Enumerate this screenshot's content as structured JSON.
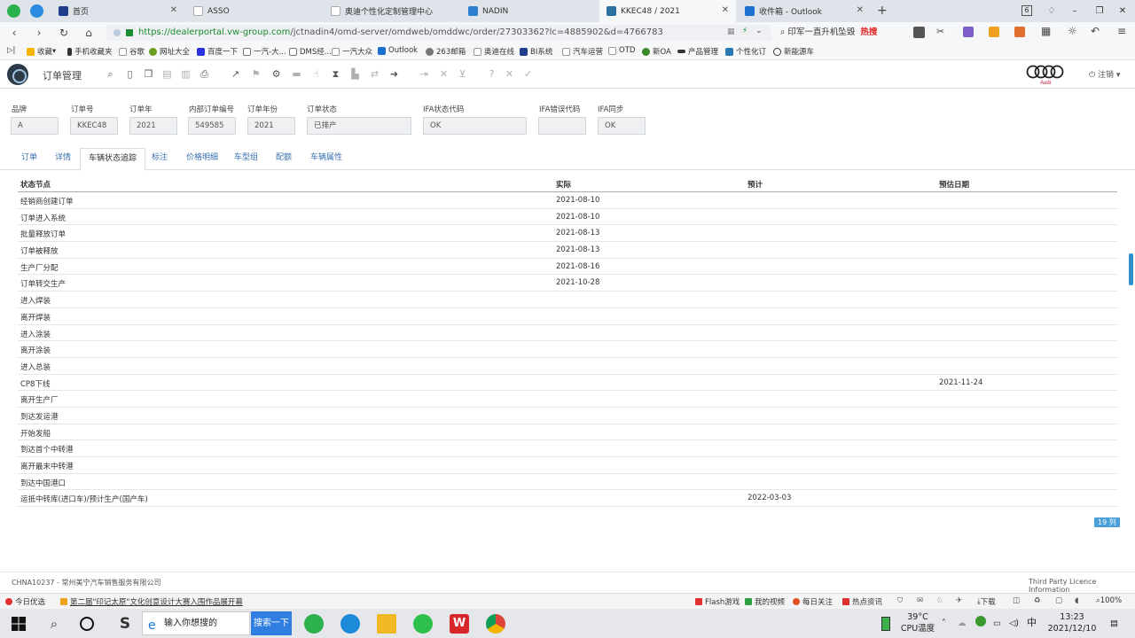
{
  "browser": {
    "tabs": [
      {
        "label": "首页",
        "color": "#1f3f8c"
      },
      {
        "label": "ASSO",
        "color": "#aaaaaa"
      },
      {
        "label": "奥迪个性化定制管理中心",
        "color": "#aaaaaa"
      },
      {
        "label": "NADIN",
        "color": "#2d7fcf"
      },
      {
        "label": "KKEC48 / 2021",
        "color": "#2d6f9f"
      },
      {
        "label": "收件箱 - Outlook",
        "color": "#1d6fd0"
      }
    ],
    "tab_count": "6",
    "url_scheme": "https://",
    "url_host": "dealerportal.vw-group.com",
    "url_path": "/jctnadin4/omd-server/omdweb/omddwc/order/27303362?lc=4885902&d=4766783",
    "search_text": "印军一直升机坠毁",
    "search_hot": "热搜",
    "bookmarks": [
      "收藏",
      "手机收藏夹",
      "谷歌",
      "网址大全",
      "百度一下",
      "一汽-大...",
      "DMS经...",
      "一汽大众",
      "Outlook",
      "263邮箱",
      "奥迪在线",
      "BI系统",
      "汽车运营",
      "OTD",
      "新OA",
      "产品管理",
      "个性化订",
      "新能源车"
    ]
  },
  "app": {
    "title": "订单管理",
    "brand": "Audi",
    "logout": "注销"
  },
  "fields": [
    {
      "label": "品牌",
      "value": "A"
    },
    {
      "label": "订单号",
      "value": "KKEC48"
    },
    {
      "label": "订单年",
      "value": "2021"
    },
    {
      "label": "内部订单编号",
      "value": "549585"
    },
    {
      "label": "订单年份",
      "value": "2021"
    },
    {
      "label": "订单状态",
      "value": "已排产"
    },
    {
      "label": "IFA状态代码",
      "value": "OK"
    },
    {
      "label": "IFA错误代码",
      "value": ""
    },
    {
      "label": "IFA同步",
      "value": "OK"
    }
  ],
  "content_tabs": [
    "订单",
    "详情",
    "车辆状态追踪",
    "标注",
    "价格明细",
    "车型组",
    "配额",
    "车辆属性"
  ],
  "table": {
    "headers": [
      "状态节点",
      "实际",
      "预计",
      "预估日期"
    ],
    "rows": [
      [
        "经销商创建订单",
        "2021-08-10",
        "",
        ""
      ],
      [
        "订单进入系统",
        "2021-08-10",
        "",
        ""
      ],
      [
        "批量释放订单",
        "2021-08-13",
        "",
        ""
      ],
      [
        "订单被释放",
        "2021-08-13",
        "",
        ""
      ],
      [
        "生产厂分配",
        "2021-08-16",
        "",
        ""
      ],
      [
        "订单转交生产",
        "2021-10-28",
        "",
        ""
      ],
      [
        "进入焊装",
        "",
        "",
        ""
      ],
      [
        "离开焊装",
        "",
        "",
        ""
      ],
      [
        "进入涂装",
        "",
        "",
        ""
      ],
      [
        "离开涂装",
        "",
        "",
        ""
      ],
      [
        "进入总装",
        "",
        "",
        ""
      ],
      [
        "CP8下线",
        "",
        "",
        "2021-11-24"
      ],
      [
        "离开生产厂",
        "",
        "",
        ""
      ],
      [
        "到达发运港",
        "",
        "",
        ""
      ],
      [
        "开始发船",
        "",
        "",
        ""
      ],
      [
        "到达首个中转港",
        "",
        "",
        ""
      ],
      [
        "离开最末中转港",
        "",
        "",
        ""
      ],
      [
        "到达中国港口",
        "",
        "",
        ""
      ],
      [
        "运抵中转库(进口车)/预计生产(国产车)",
        "",
        "2022-03-03",
        ""
      ]
    ],
    "count": "19 列"
  },
  "footer": {
    "left": "CHNA10237 - 常州美宁汽车销售服务有限公司",
    "right": "Third Party Licence Information"
  },
  "statusbar": {
    "today": "今日优选",
    "news": "第二届\"印记太原\"文化创意设计大赛入围作品展开幕",
    "items": [
      "Flash游戏",
      "我的视频",
      "每日关注",
      "热点资讯"
    ],
    "download": "下载",
    "zoom": "100%"
  },
  "taskbar": {
    "search_placeholder": "输入你想搜的",
    "search_button": "搜索一下",
    "temperature": "39°C",
    "temp_label": "CPU温度",
    "ime": "中",
    "time": "13:23",
    "date": "2021/12/10"
  }
}
